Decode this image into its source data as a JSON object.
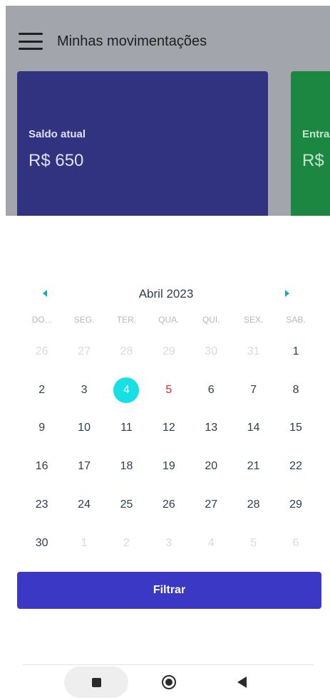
{
  "header": {
    "title": "Minhas movimentações"
  },
  "cards": [
    {
      "label": "Saldo atual",
      "value": "R$ 650",
      "color": "#323380"
    },
    {
      "label": "Entra",
      "value": "R$",
      "color": "#1c8741"
    }
  ],
  "calendar": {
    "month_label": "Abril 2023",
    "weekdays": [
      "DO...",
      "SEG.",
      "TER.",
      "QUA.",
      "QUI.",
      "SEX.",
      "SAB."
    ],
    "weeks": [
      [
        {
          "d": "26",
          "muted": true
        },
        {
          "d": "27",
          "muted": true
        },
        {
          "d": "28",
          "muted": true
        },
        {
          "d": "29",
          "muted": true
        },
        {
          "d": "30",
          "muted": true
        },
        {
          "d": "31",
          "muted": true
        },
        {
          "d": "1"
        }
      ],
      [
        {
          "d": "2"
        },
        {
          "d": "3"
        },
        {
          "d": "4",
          "selected": true
        },
        {
          "d": "5",
          "holiday": true
        },
        {
          "d": "6"
        },
        {
          "d": "7"
        },
        {
          "d": "8"
        }
      ],
      [
        {
          "d": "9"
        },
        {
          "d": "10"
        },
        {
          "d": "11"
        },
        {
          "d": "12"
        },
        {
          "d": "13"
        },
        {
          "d": "14"
        },
        {
          "d": "15"
        }
      ],
      [
        {
          "d": "16"
        },
        {
          "d": "17"
        },
        {
          "d": "18"
        },
        {
          "d": "19"
        },
        {
          "d": "20"
        },
        {
          "d": "21"
        },
        {
          "d": "22"
        }
      ],
      [
        {
          "d": "23"
        },
        {
          "d": "24"
        },
        {
          "d": "25"
        },
        {
          "d": "26"
        },
        {
          "d": "27"
        },
        {
          "d": "28"
        },
        {
          "d": "29"
        }
      ],
      [
        {
          "d": "30"
        },
        {
          "d": "1",
          "muted": true
        },
        {
          "d": "2",
          "muted": true
        },
        {
          "d": "3",
          "muted": true
        },
        {
          "d": "4",
          "muted": true
        },
        {
          "d": "5",
          "muted": true
        },
        {
          "d": "6",
          "muted": true
        }
      ]
    ],
    "colors": {
      "selected": "#16e0e4",
      "holiday": "#e0282d",
      "arrows": "#1aa7c8"
    }
  },
  "filter_button": {
    "label": "Filtrar",
    "color": "#3a38c4"
  },
  "system_nav": {
    "icons": [
      "recent-apps-icon",
      "home-icon",
      "back-icon"
    ]
  }
}
